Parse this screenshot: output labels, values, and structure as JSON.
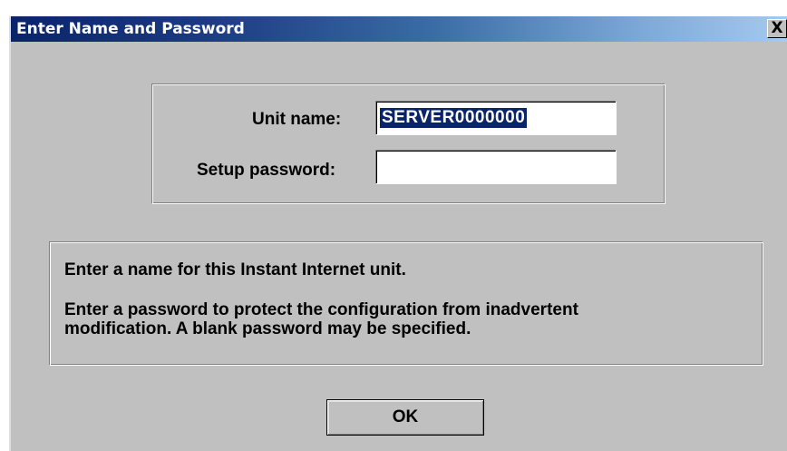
{
  "window": {
    "title": "Enter Name and Password",
    "close_label": "X"
  },
  "form": {
    "unit_name_label": "Unit name:",
    "unit_name_value": "SERVER0000000",
    "setup_password_label": "Setup password:",
    "setup_password_value": ""
  },
  "help": {
    "line1": "Enter a name for this Instant Internet unit.",
    "line2": "Enter a password to protect the configuration from inadvertent",
    "line3": "modification.  A blank password may be specified."
  },
  "buttons": {
    "ok_label": "OK"
  },
  "colors": {
    "titlebar_start": "#0a246a",
    "titlebar_end": "#a6caf0",
    "dialog_face": "#c0c0c0",
    "selection": "#0a246a"
  }
}
